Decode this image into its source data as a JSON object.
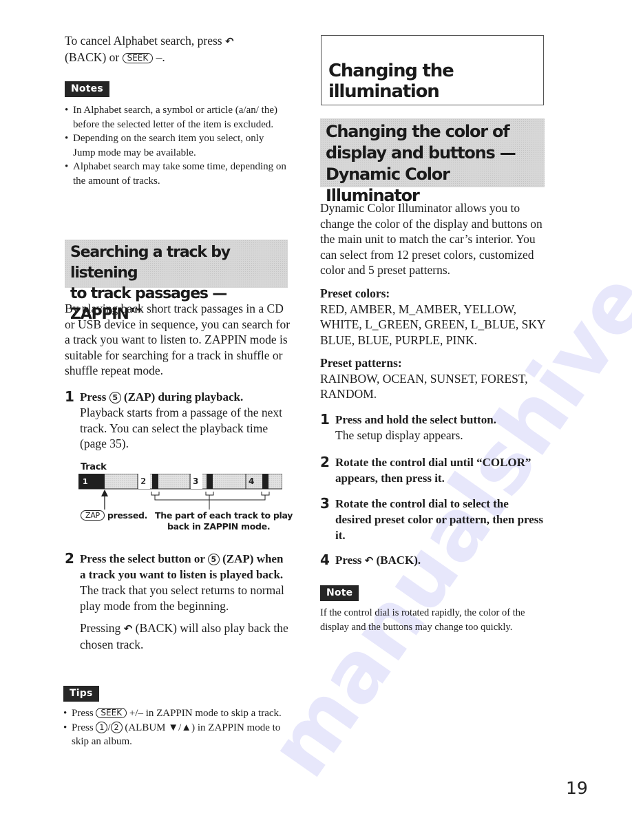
{
  "page_number": "19",
  "left": {
    "intro": {
      "line1": "To cancel Alphabet search, press",
      "back_label": "(BACK) or",
      "seek_key": "SEEK",
      "suffix": "–."
    },
    "notes": {
      "label": "Notes",
      "items": [
        "In Alphabet search, a symbol or article (a/an/ the) before the selected letter of the item is excluded.",
        "Depending on the search item you select, only Jump mode may be available.",
        "Alphabet search may take some time, depending on the amount of tracks."
      ]
    },
    "zappin_heading": {
      "line1": "Searching a track by listening",
      "line2": "to track passages — ZAPPIN™"
    },
    "zappin_intro": "By playing back short track passages in a CD or USB device in sequence, you can search for a track you want to listen to. ZAPPIN mode is suitable for searching for a track in shuffle or shuffle repeat mode.",
    "steps": [
      {
        "num": "1",
        "title_pre": "Press",
        "key": "5",
        "title_post": "(ZAP) during playback.",
        "body": "Playback starts from a passage of the next track. You can select the playback time (page 35)."
      },
      {
        "num": "2",
        "title_pre": "Press the select button or",
        "key": "5",
        "title_post": "(ZAP) when a track you want to listen is played back.",
        "body": "The track that you select returns to normal play mode from the beginning.",
        "body2_pre": "Pressing",
        "body2_post": "(BACK) will also play back the chosen track."
      }
    ],
    "diagram": {
      "label": "Track",
      "tracks": [
        "1",
        "2",
        "3",
        "4"
      ],
      "zap_key": "ZAP",
      "zap_caption": "pressed.",
      "part_caption_line1": "The part of each track to play",
      "part_caption_line2": "back in ZAPPIN mode."
    },
    "tips": {
      "label": "Tips",
      "items": [
        {
          "pre": "Press",
          "key": "SEEK",
          "post": "+/– in ZAPPIN mode to skip a track."
        },
        {
          "pre": "Press",
          "key1": "1",
          "sep": "/",
          "key2": "2",
          "post": "(ALBUM ▼/▲) in ZAPPIN mode to skip an album."
        }
      ]
    }
  },
  "right": {
    "section_title": {
      "line1": "Changing the",
      "line2": "illumination"
    },
    "sub_heading": {
      "line1": "Changing the color of",
      "line2": "display and buttons —",
      "line3": "Dynamic Color Illuminator"
    },
    "intro": "Dynamic Color Illuminator allows you to change the color of the display and buttons on the main unit to match the car’s interior. You can select from 12 preset colors, customized color and 5 preset patterns.",
    "preset_colors": {
      "label": "Preset colors:",
      "values": "RED, AMBER, M_AMBER, YELLOW, WHITE, L_GREEN, GREEN, L_BLUE, SKY BLUE, BLUE, PURPLE, PINK."
    },
    "preset_patterns": {
      "label": "Preset patterns:",
      "values": "RAINBOW, OCEAN, SUNSET, FOREST, RANDOM."
    },
    "steps": [
      {
        "num": "1",
        "title": "Press and hold the select button.",
        "body": "The setup display appears."
      },
      {
        "num": "2",
        "title": "Rotate the control dial until “COLOR” appears, then press it."
      },
      {
        "num": "3",
        "title": "Rotate the control dial to select the desired preset color or pattern, then press it."
      },
      {
        "num": "4",
        "title_pre": "Press",
        "title_post": "(BACK)."
      }
    ],
    "note": {
      "label": "Note",
      "text": "If the control dial is rotated rapidly, the color of the display and the buttons may change too quickly."
    }
  },
  "icons": {
    "back": "↶"
  }
}
